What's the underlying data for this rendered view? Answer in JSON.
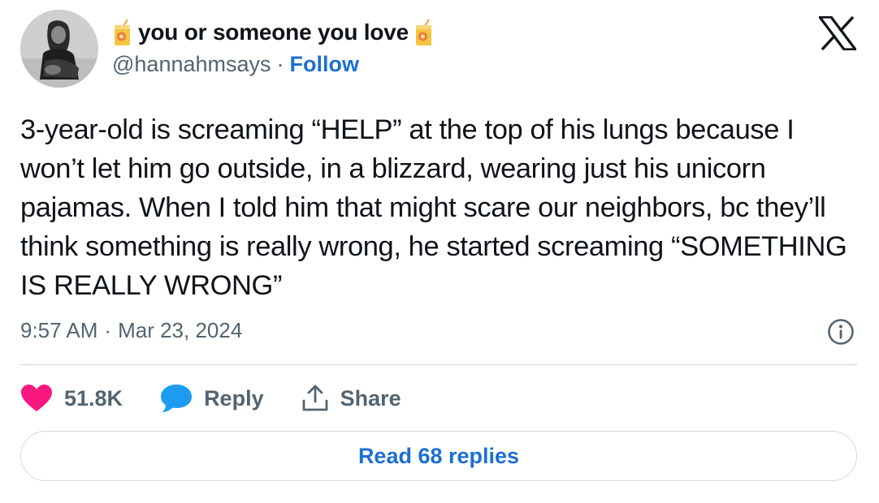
{
  "author": {
    "display_name": "you or someone you love",
    "handle": "@hannahmsays",
    "separator": "·",
    "follow_label": "Follow",
    "name_emoji": "juice-box-emoji"
  },
  "tweet": {
    "text": "3-year-old is screaming “HELP” at the top of his lungs because I won’t let him go outside, in a blizzard, wearing just his unicorn pajamas. When I told him that might scare our neighbors, bc they’ll think something is really wrong, he started screaming “SOMETHING IS REALLY WRONG”",
    "time": "9:57 AM",
    "separator": "·",
    "date": "Mar 23, 2024"
  },
  "actions": {
    "like_count": "51.8K",
    "reply_label": "Reply",
    "share_label": "Share"
  },
  "footer": {
    "read_replies_label": "Read 68 replies"
  },
  "colors": {
    "like": "#f91880",
    "reply": "#1d9bf0",
    "link": "#1d6fd1",
    "muted": "#536471"
  },
  "icons": [
    "x-logo-icon",
    "info-icon",
    "heart-icon",
    "speech-bubble-icon",
    "share-icon",
    "juice-box-emoji"
  ]
}
